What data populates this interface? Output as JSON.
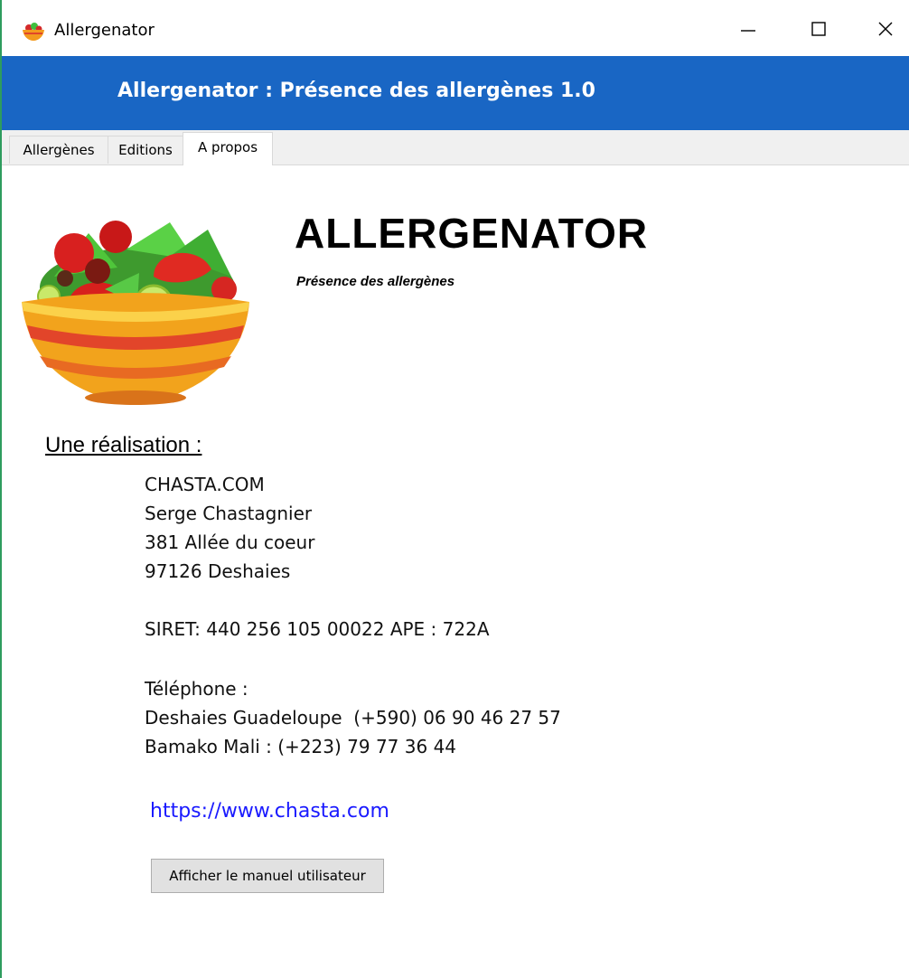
{
  "window": {
    "title": "Allergenator",
    "app_icon": "salad-bowl-icon",
    "controls": [
      "minimize-icon",
      "maximize-icon",
      "close-icon"
    ]
  },
  "header": {
    "title": "Allergenator : Présence des allergènes 1.0",
    "background_color": "#1966c4"
  },
  "tabs": [
    {
      "label": "Allergènes",
      "active": false
    },
    {
      "label": "Editions",
      "active": false
    },
    {
      "label": "A propos",
      "active": true
    }
  ],
  "about": {
    "app_name": "ALLERGENATOR",
    "subtitle": "Présence des allergènes",
    "made_by_label": "Une réalisation :",
    "company": "CHASTA.COM",
    "person": "Serge Chastagnier",
    "street": "381 Allée du coeur",
    "city": "97126 Deshaies",
    "siret": "SIRET: 440 256 105 00022 APE : 722A",
    "phone_label": "Téléphone :",
    "phone_1": "Deshaies Guadeloupe  (+590) 06 90 46 27 57",
    "phone_2": "Bamako Mali : (+223) 79 77 36 44",
    "website": "https://www.chasta.com",
    "manual_button": "Afficher le manuel utilisateur",
    "link_color": "#1a1aff"
  }
}
